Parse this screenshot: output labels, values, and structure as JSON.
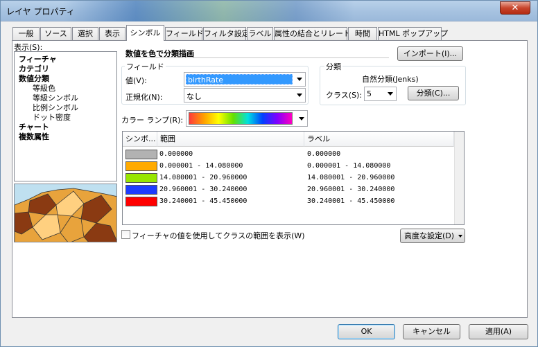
{
  "window": {
    "title": "レイヤ プロパティ",
    "close_glyph": "✕"
  },
  "tabs": [
    "一般",
    "ソース",
    "選択",
    "表示",
    "シンボル",
    "フィールド",
    "フィルタ設定",
    "ラベル",
    "属性の結合とリレート",
    "時間",
    "HTML ポップアップ"
  ],
  "active_tab": "シンボル",
  "show_label": "表示(S):",
  "tree": [
    {
      "label": "フィーチャ",
      "bold": true,
      "indent": 0
    },
    {
      "label": "カテゴリ",
      "bold": true,
      "indent": 0
    },
    {
      "label": "数値分類",
      "bold": true,
      "indent": 0
    },
    {
      "label": "等級色",
      "bold": false,
      "indent": 1
    },
    {
      "label": "等級シンボル",
      "bold": false,
      "indent": 1
    },
    {
      "label": "比例シンボル",
      "bold": false,
      "indent": 1
    },
    {
      "label": "ドット密度",
      "bold": false,
      "indent": 1
    },
    {
      "label": "チャート",
      "bold": true,
      "indent": 0
    },
    {
      "label": "複数属性",
      "bold": true,
      "indent": 0
    }
  ],
  "heading": "数値を色で分類描画",
  "import_button": "インポート(I)...",
  "fields_group": {
    "title": "フィールド",
    "value_label": "値(V):",
    "value": "birthRate",
    "normalize_label": "正規化(N):",
    "normalize_value": "なし"
  },
  "classification_group": {
    "title": "分類",
    "method": "自然分類(Jenks)",
    "classes_label": "クラス(S):",
    "classes_value": "5",
    "classify_button": "分類(C)..."
  },
  "color_ramp_label": "カラー ランプ(R):",
  "color_ramp": [
    "#ff3b3b",
    "#ffa000",
    "#ffff00",
    "#64e000",
    "#00e0e0",
    "#0040ff",
    "#8000ff",
    "#ff00c0"
  ],
  "grid": {
    "headers": [
      "シンボ...",
      "範囲",
      "ラベル"
    ],
    "rows": [
      {
        "color": "#b2b2b2",
        "range": "0.000000",
        "label": "0.000000"
      },
      {
        "color": "#ffaa00",
        "range": "0.000001 - 14.080000",
        "label": "0.000001 - 14.080000"
      },
      {
        "color": "#98e600",
        "range": "14.080001 - 20.960000",
        "label": "14.080001 - 20.960000"
      },
      {
        "color": "#1e3cff",
        "range": "20.960001 - 30.240000",
        "label": "20.960001 - 30.240000"
      },
      {
        "color": "#ff0000",
        "range": "30.240001 - 45.450000",
        "label": "30.240001 - 45.450000"
      }
    ]
  },
  "show_class_ranges_label": "フィーチャの値を使用してクラスの範囲を表示(W)",
  "advanced_button": "高度な設定(D)",
  "footer": {
    "ok": "OK",
    "cancel": "キャンセル",
    "apply": "適用(A)"
  }
}
